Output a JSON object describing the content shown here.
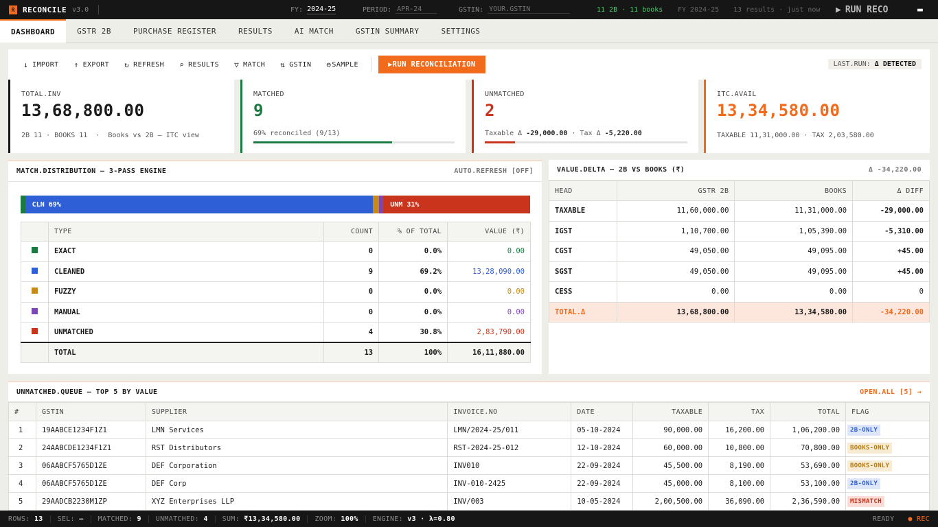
{
  "app": {
    "logo": "R",
    "title": "RECONCILE",
    "version": "v3.0"
  },
  "topbar": {
    "fy_label": "FY:",
    "fy_value": "2024-25",
    "period_label": "PERIOD:",
    "period_placeholder": "APR-24",
    "gstin_label": "GSTIN:",
    "gstin_placeholder": "YOUR.GSTIN",
    "counts": "11 2B · 11 books",
    "fy_short": "FY 2024-25",
    "results": "13 results · just now",
    "run_label": "RUN RECO"
  },
  "tabs": [
    "DASHBOARD",
    "GSTR 2B",
    "PURCHASE REGISTER",
    "RESULTS",
    "AI MATCH",
    "GSTIN SUMMARY",
    "SETTINGS"
  ],
  "toolbar": {
    "buttons": [
      {
        "icon": "↓",
        "label": "IMPORT"
      },
      {
        "icon": "↑",
        "label": "EXPORT"
      },
      {
        "icon": "↻",
        "label": "REFRESH"
      },
      {
        "icon": "⌕",
        "label": "RESULTS"
      },
      {
        "icon": "▽",
        "label": "MATCH"
      },
      {
        "icon": "⇅",
        "label": "GSTIN"
      },
      {
        "icon": "⊖",
        "label": "SAMPLE"
      }
    ],
    "run_label": "▶RUN RECONCILIATION",
    "lastrun_label": "LAST.RUN:",
    "lastrun_value": "Δ DETECTED"
  },
  "cards": [
    {
      "label": "TOTAL.INV",
      "value": "13,68,800.00",
      "sub": "2B 11 · BOOKS 11  ·  Books vs 2B — ITC view",
      "color": "#111111",
      "accent": "#161616"
    },
    {
      "label": "MATCHED",
      "value": "9",
      "sub": "69% reconciled (9/13)",
      "color": "#1a7a42",
      "accent": "#1a7a42",
      "progress": 0.69
    },
    {
      "label": "UNMATCHED",
      "value": "2",
      "sub_a": "Taxable Δ ",
      "sub_b": "-29,000.00",
      "sub_c": " · Tax Δ ",
      "sub_d": "-5,220.00",
      "color": "#c8341c",
      "accent": "#c8341c",
      "progress": 0.15
    },
    {
      "label": "ITC.AVAIL",
      "value": "13,34,580.00",
      "sub": "TAXABLE 11,31,000.00 · TAX 2,03,580.00",
      "color": "#f26a1b",
      "accent": "#f26a1b"
    }
  ],
  "match_panel": {
    "title": "MATCH.DISTRIBUTION — 3-PASS ENGINE",
    "auto_refresh": "AUTO.REFRESH [OFF]",
    "strip": [
      {
        "label": "",
        "share": 0.009,
        "color": "#1a7a42"
      },
      {
        "label": "CLN 69%",
        "share": 0.683,
        "color": "#2e5fd6"
      },
      {
        "label": "",
        "share": 0.011,
        "color": "#c68a1a"
      },
      {
        "label": "",
        "share": 0.009,
        "color": "#7b48b3"
      },
      {
        "label": "UNM 31%",
        "share": 0.288,
        "color": "#c8341c"
      }
    ],
    "headers": [
      "",
      "TYPE",
      "COUNT",
      "% OF TOTAL",
      "VALUE (₹)"
    ],
    "rows": [
      {
        "type": "EXACT",
        "count": "0",
        "pct": "0.0%",
        "value": "0.00",
        "color": "#1a7a42"
      },
      {
        "type": "CLEANED",
        "count": "9",
        "pct": "69.2%",
        "value": "13,28,090.00",
        "color": "#2e5fd6"
      },
      {
        "type": "FUZZY",
        "count": "0",
        "pct": "0.0%",
        "value": "0.00",
        "color": "#c68a1a"
      },
      {
        "type": "MANUAL",
        "count": "0",
        "pct": "0.0%",
        "value": "0.00",
        "color": "#7b48b3"
      },
      {
        "type": "UNMATCHED",
        "count": "4",
        "pct": "30.8%",
        "value": "2,83,790.00",
        "color": "#c8341c"
      }
    ],
    "total": {
      "type": "TOTAL",
      "count": "13",
      "pct": "100%",
      "value": "16,11,880.00"
    }
  },
  "delta_panel": {
    "title": "VALUE.DELTA — 2B VS BOOKS (₹)",
    "delta": "Δ -34,220.00",
    "headers": [
      "HEAD",
      "GSTR 2B",
      "BOOKS",
      "Δ DIFF"
    ],
    "rows": [
      {
        "head": "TAXABLE",
        "gstr": "11,60,000.00",
        "books": "11,31,000.00",
        "diff": "-29,000.00"
      },
      {
        "head": "IGST",
        "gstr": "1,10,700.00",
        "books": "1,05,390.00",
        "diff": "-5,310.00"
      },
      {
        "head": "CGST",
        "gstr": "49,050.00",
        "books": "49,095.00",
        "diff": "+45.00"
      },
      {
        "head": "SGST",
        "gstr": "49,050.00",
        "books": "49,095.00",
        "diff": "+45.00"
      },
      {
        "head": "CESS",
        "gstr": "0.00",
        "books": "0.00",
        "diff": "0"
      }
    ],
    "total": {
      "head": "TOTAL.Δ",
      "gstr": "13,68,800.00",
      "books": "13,34,580.00",
      "diff": "-34,220.00"
    }
  },
  "queue": {
    "title": "UNMATCHED.QUEUE — TOP 5 BY VALUE",
    "open_all": "OPEN.ALL [5] →",
    "headers": [
      "#",
      "GSTIN",
      "SUPPLIER",
      "INVOICE.NO",
      "DATE",
      "TAXABLE",
      "TAX",
      "TOTAL",
      "FLAG"
    ],
    "rows": [
      {
        "n": "1",
        "gstin": "19AABCE1234F1Z1",
        "supplier": "LMN Services",
        "inv": "LMN/2024-25/011",
        "date": "05-10-2024",
        "taxable": "90,000.00",
        "tax": "16,200.00",
        "total": "1,06,200.00",
        "flag": "2B-ONLY",
        "flag_bg": "#dde6fb",
        "flag_fg": "#2e5fd6"
      },
      {
        "n": "2",
        "gstin": "24AABCDE1234F1Z1",
        "supplier": "RST Distributors",
        "inv": "RST-2024-25-012",
        "date": "12-10-2024",
        "taxable": "60,000.00",
        "tax": "10,800.00",
        "total": "70,800.00",
        "flag": "BOOKS-ONLY",
        "flag_bg": "#f7ecd3",
        "flag_fg": "#b57a10"
      },
      {
        "n": "3",
        "gstin": "06AABCF5765D1ZE",
        "supplier": "DEF Corporation",
        "inv": "INV010",
        "date": "22-09-2024",
        "taxable": "45,500.00",
        "tax": "8,190.00",
        "total": "53,690.00",
        "flag": "BOOKS-ONLY",
        "flag_bg": "#f7ecd3",
        "flag_fg": "#b57a10"
      },
      {
        "n": "4",
        "gstin": "06AABCF5765D1ZE",
        "supplier": "DEF Corp",
        "inv": "INV-010-2425",
        "date": "22-09-2024",
        "taxable": "45,000.00",
        "tax": "8,100.00",
        "total": "53,100.00",
        "flag": "2B-ONLY",
        "flag_bg": "#dde6fb",
        "flag_fg": "#2e5fd6"
      },
      {
        "n": "5",
        "gstin": "29AADCB2230M1ZP",
        "supplier": "XYZ Enterprises LLP",
        "inv": "INV/003",
        "date": "10-05-2024",
        "taxable": "2,00,500.00",
        "tax": "36,090.00",
        "total": "2,36,590.00",
        "flag": "MISMATCH",
        "flag_bg": "#fbdcd6",
        "flag_fg": "#c8341c"
      }
    ]
  },
  "status": {
    "rows_label": "ROWS:",
    "rows": "13",
    "sel_label": "SEL:",
    "sel": "—",
    "matched_label": "MATCHED:",
    "matched": "9",
    "unmatched_label": "UNMATCHED:",
    "unmatched": "4",
    "sum_label": "SUM:",
    "sum": "₹13,34,580.00",
    "zoom_label": "ZOOM:",
    "zoom": "100%",
    "engine_label": "ENGINE:",
    "engine": "v3 · λ=0.80",
    "ready": "READY",
    "rec": "● REC"
  }
}
